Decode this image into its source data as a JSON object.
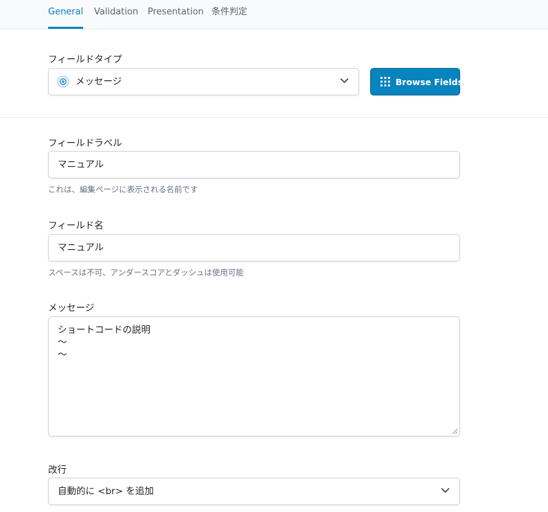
{
  "tabs": [
    {
      "label": "General",
      "active": true
    },
    {
      "label": "Validation",
      "active": false
    },
    {
      "label": "Presentation",
      "active": false
    },
    {
      "label": "条件判定",
      "active": false
    }
  ],
  "field_type": {
    "label": "フィールドタイプ",
    "value": "メッセージ",
    "icon": "radio-target-icon",
    "browse_label": "Browse Fields"
  },
  "field_label": {
    "label": "フィールドラベル",
    "value": "マニュアル",
    "help": "これは、編集ページに表示される名前です"
  },
  "field_name": {
    "label": "フィールド名",
    "value": "マニュアル",
    "help": "スペースは不可、アンダースコアとダッシュは使用可能"
  },
  "message": {
    "label": "メッセージ",
    "lines": [
      "ショートコードの説明",
      "～",
      "～"
    ]
  },
  "line_break": {
    "label": "改行",
    "value": "自動的に <br> を追加"
  },
  "colors": {
    "accent": "#0783be",
    "border": "#cfd4d9",
    "help_text": "#667085"
  }
}
